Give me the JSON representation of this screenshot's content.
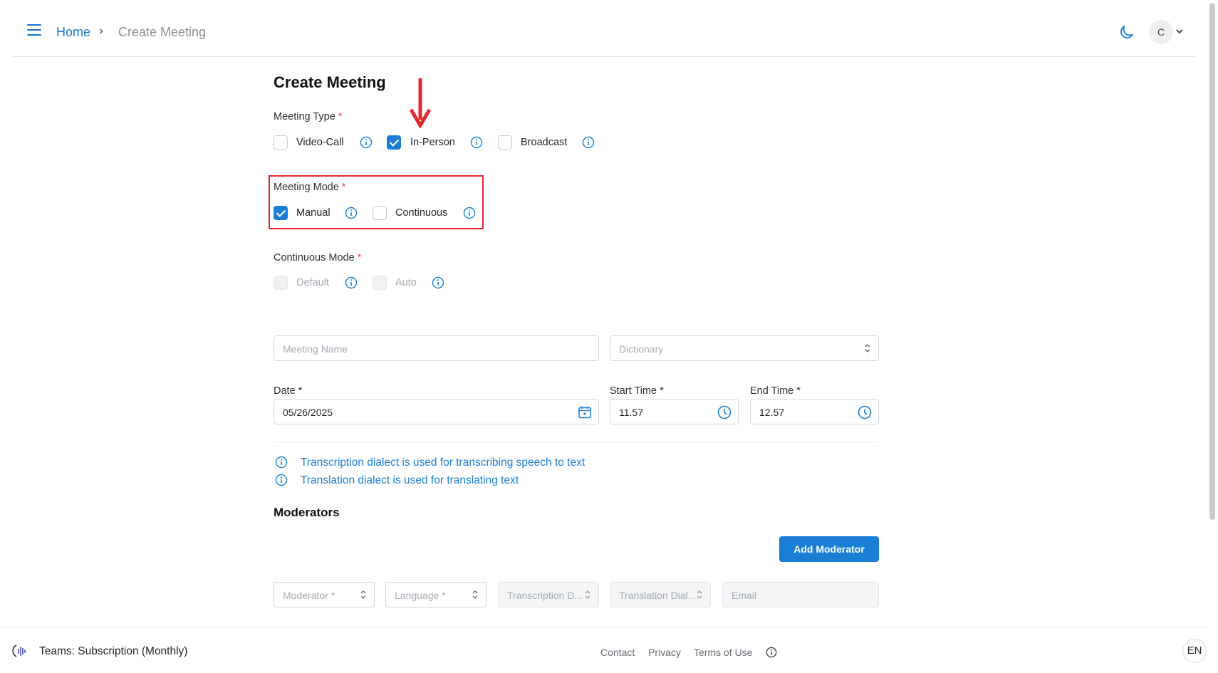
{
  "breadcrumb": {
    "home": "Home",
    "separator": "›",
    "current": "Create Meeting"
  },
  "header": {
    "avatar_initial": "C",
    "icons": [
      "menu-icon",
      "moon-icon",
      "chevron-down-icon"
    ]
  },
  "form": {
    "title": "Create Meeting",
    "meeting_type": {
      "label": "Meeting Type",
      "required_mark": "*",
      "options": [
        {
          "label": "Video-Call",
          "checked": false
        },
        {
          "label": "In-Person",
          "checked": true
        },
        {
          "label": "Broadcast",
          "checked": false
        }
      ]
    },
    "meeting_mode": {
      "label": "Meeting Mode",
      "required_mark": "*",
      "options": [
        {
          "label": "Manual",
          "checked": true
        },
        {
          "label": "Continuous",
          "checked": false
        }
      ]
    },
    "continuous_mode": {
      "label": "Continuous Mode",
      "required_mark": "*",
      "options": [
        {
          "label": "Default",
          "checked": false,
          "disabled": true
        },
        {
          "label": "Auto",
          "checked": false,
          "disabled": true
        }
      ]
    },
    "meeting_name_placeholder": "Meeting Name",
    "dictionary_placeholder": "Dictionary",
    "date": {
      "label": "Date *",
      "value": "05/26/2025"
    },
    "start_time": {
      "label": "Start Time *",
      "value": "11.57"
    },
    "end_time": {
      "label": "End Time *",
      "value": "12.57"
    },
    "notes": [
      "Transcription dialect is used for transcribing speech to text",
      "Translation dialect is used for translating text"
    ],
    "moderators": {
      "title": "Moderators",
      "add_button": "Add Moderator",
      "row": {
        "moderator": "Moderator *",
        "language": "Language *",
        "transcription": "Transcription D...",
        "translation": "Translation Dial...",
        "email": "Email"
      }
    }
  },
  "footer": {
    "plan": "Teams: Subscription (Monthly)",
    "links": [
      "Contact",
      "Privacy",
      "Terms of Use"
    ],
    "language": "EN"
  },
  "colors": {
    "accent": "#1a7fd4",
    "highlight": "#e3262d"
  }
}
